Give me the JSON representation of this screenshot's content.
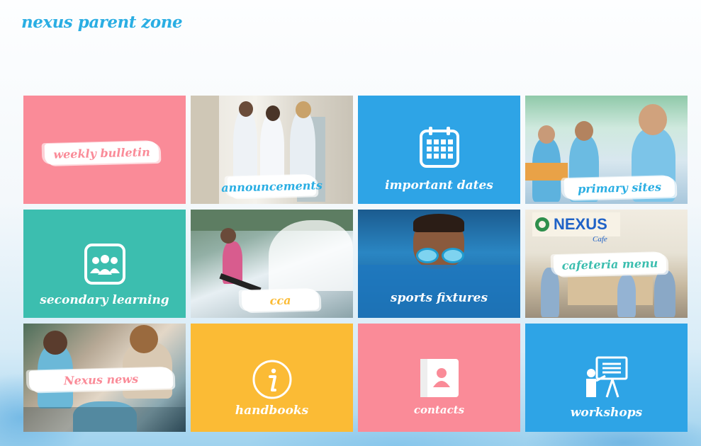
{
  "brand": {
    "title": "nexus parent zone"
  },
  "tiles": {
    "weekly_bulletin": {
      "label": "weekly bulletin",
      "color": "#fa8b98"
    },
    "announcements": {
      "label": "announcements"
    },
    "important_dates": {
      "label": "important dates",
      "color": "#2ea4e6",
      "icon": "calendar-icon"
    },
    "primary_sites": {
      "label": "primary sites"
    },
    "secondary_learning": {
      "label": "secondary learning",
      "color": "#3cbeaf",
      "icon": "group-icon"
    },
    "cca": {
      "label": "cca"
    },
    "sports_fixtures": {
      "label": "sports fixtures"
    },
    "cafeteria_menu": {
      "label": "cafeteria menu",
      "sign": "NEXUS",
      "sign_sub": "Cafe"
    },
    "nexus_news": {
      "label": "Nexus news"
    },
    "handbooks": {
      "label": "handbooks",
      "color": "#fbbb35",
      "icon": "info-icon"
    },
    "contacts": {
      "label": "contacts",
      "color": "#fa8b98",
      "icon": "contact-card-icon"
    },
    "workshops": {
      "label": "workshops",
      "color": "#2ea4e6",
      "icon": "presentation-icon"
    }
  },
  "colors": {
    "accent": "#2aaee3",
    "teal_text": "#3cbeaf",
    "pink_text": "#fa8b98",
    "yellow_text": "#fbbb35"
  }
}
